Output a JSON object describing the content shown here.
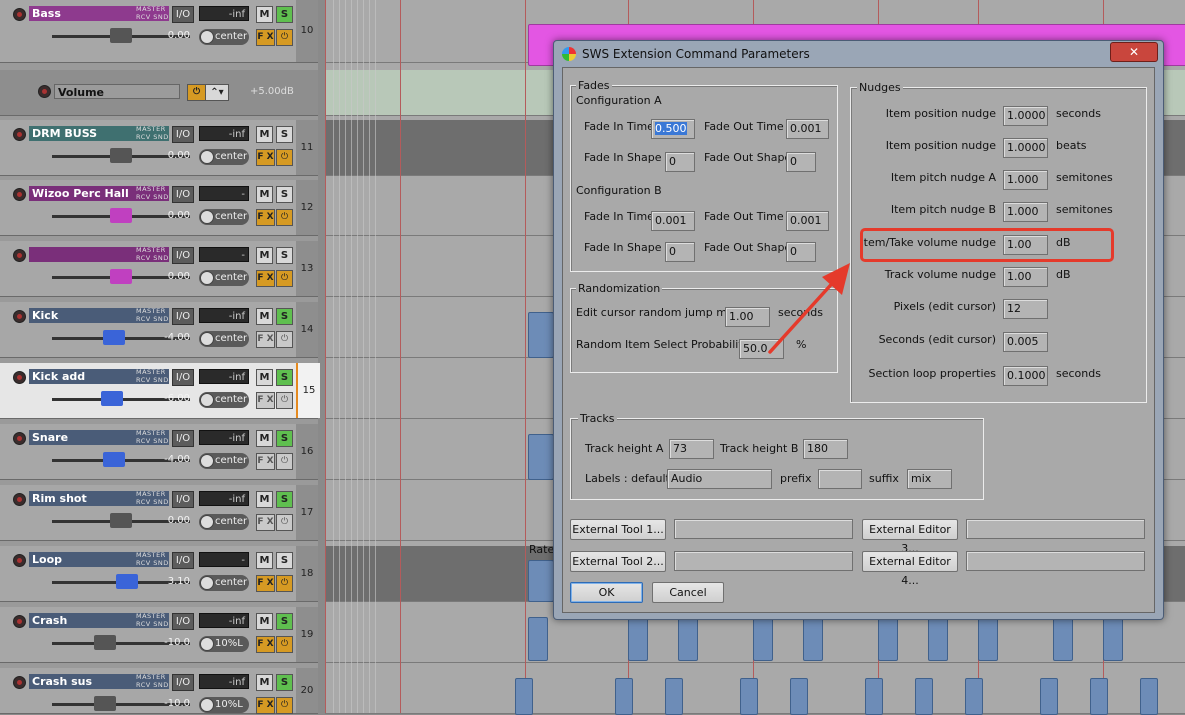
{
  "tracks": [
    {
      "num": "10",
      "name": "Bass",
      "io": "I/O",
      "meter": "-inf",
      "db": "0.00",
      "pan": "center",
      "solo_on": true,
      "fx_on": true,
      "color": "#8e3a8e",
      "knob_color": "#555555",
      "fader": 0.5
    },
    {
      "num": "",
      "name": "Volume",
      "env": true,
      "env_value": "+5.00dB"
    },
    {
      "num": "11",
      "name": "DRM BUSS",
      "io": "I/O",
      "meter": "-inf",
      "db": "0.00",
      "pan": "center",
      "solo_on": false,
      "fx_on": true,
      "color": "#3f7070",
      "knob_color": "#555555",
      "fader": 0.5
    },
    {
      "num": "12",
      "name": "Wizoo Perc Hall",
      "io": "I/O",
      "meter": "-",
      "db": "0.00",
      "pan": "center",
      "solo_on": false,
      "fx_on": true,
      "color": "#7a2f7a",
      "knob_color": "#c040c0",
      "fader": 0.5
    },
    {
      "num": "13",
      "name": "",
      "io": "I/O",
      "meter": "-",
      "db": "0.00",
      "pan": "center",
      "solo_on": false,
      "fx_on": true,
      "color": "#7a2f7a",
      "knob_color": "#c040c0",
      "fader": 0.5
    },
    {
      "num": "14",
      "name": "Kick",
      "io": "I/O",
      "meter": "-inf",
      "db": "-4.00",
      "pan": "center",
      "solo_on": true,
      "fx_on": false,
      "color": "#4a5c78",
      "knob_color": "#3a64d8",
      "fader": 0.44
    },
    {
      "num": "15",
      "name": "Kick add",
      "io": "I/O",
      "meter": "-inf",
      "db": "-6.00",
      "pan": "center",
      "solo_on": true,
      "fx_on": false,
      "color": "#4a5c78",
      "knob_color": "#3a64d8",
      "fader": 0.42,
      "selected": true
    },
    {
      "num": "16",
      "name": "Snare",
      "io": "I/O",
      "meter": "-inf",
      "db": "-4.00",
      "pan": "center",
      "solo_on": true,
      "fx_on": false,
      "color": "#4a5c78",
      "knob_color": "#3a64d8",
      "fader": 0.44
    },
    {
      "num": "17",
      "name": "Rim shot",
      "io": "I/O",
      "meter": "-inf",
      "db": "0.00",
      "pan": "center",
      "solo_on": true,
      "fx_on": false,
      "color": "#4a5c78",
      "knob_color": "#555555",
      "fader": 0.5
    },
    {
      "num": "18",
      "name": "Loop",
      "io": "I/O",
      "meter": "-",
      "db": "3.10",
      "pan": "center",
      "solo_on": false,
      "fx_on": true,
      "color": "#4a5c78",
      "knob_color": "#3a64d8",
      "fader": 0.55
    },
    {
      "num": "19",
      "name": "Crash",
      "io": "I/O",
      "meter": "-inf",
      "db": "-10.0",
      "pan": "10%L",
      "solo_on": true,
      "fx_on": true,
      "color": "#4a5c78",
      "knob_color": "#555555",
      "fader": 0.36
    },
    {
      "num": "20",
      "name": "Crash  sus",
      "io": "I/O",
      "meter": "-inf",
      "db": "-10.0",
      "pan": "10%L",
      "solo_on": true,
      "fx_on": true,
      "color": "#4a5c78",
      "knob_color": "#555555",
      "fader": 0.36
    }
  ],
  "track_labels": {
    "master": "MASTER",
    "rcv": "RCV SND",
    "mute": "M",
    "solo": "S",
    "fx": "F X",
    "power": "⏻"
  },
  "arrange": {
    "clip_label": "Rate"
  },
  "dialog": {
    "title": "SWS Extension Command Parameters",
    "close": "✕",
    "fades": {
      "group": "Fades",
      "config_a": "Configuration A",
      "config_b": "Configuration B",
      "fade_in_time": "Fade In Time",
      "fade_out_time": "Fade Out Time",
      "fade_in_shape": "Fade In Shape",
      "fade_out_shape": "Fade Out Shape",
      "a_in_time": "0.500",
      "a_out_time": "0.001",
      "a_in_shape": "0",
      "a_out_shape": "0",
      "b_in_time": "0.001",
      "b_out_time": "0.001",
      "b_in_shape": "0",
      "b_out_shape": "0"
    },
    "randomization": {
      "group": "Randomization",
      "jump_label": "Edit cursor random jump mean",
      "jump_value": "1.00",
      "jump_unit": "seconds",
      "prob_label": "Random Item Select Probability",
      "prob_value": "50.0",
      "prob_unit": "%"
    },
    "nudges": {
      "group": "Nudges",
      "rows": [
        {
          "label": "Item position nudge",
          "value": "1.0000",
          "unit": "seconds"
        },
        {
          "label": "Item position nudge",
          "value": "1.0000",
          "unit": "beats"
        },
        {
          "label": "Item pitch nudge A",
          "value": "1.000",
          "unit": "semitones"
        },
        {
          "label": "Item pitch nudge B",
          "value": "1.000",
          "unit": "semitones"
        },
        {
          "label": "Item/Take volume nudge",
          "value": "1.00",
          "unit": "dB"
        },
        {
          "label": "Track volume nudge",
          "value": "1.00",
          "unit": "dB"
        },
        {
          "label": "Pixels (edit cursor)",
          "value": "12",
          "unit": ""
        },
        {
          "label": "Seconds (edit cursor)",
          "value": "0.005",
          "unit": ""
        },
        {
          "label": "Section loop properties",
          "value": "0.1000",
          "unit": "seconds"
        }
      ]
    },
    "tracks": {
      "group": "Tracks",
      "height_a_label": "Track height A",
      "height_a": "73",
      "height_b_label": "Track height B",
      "height_b": "180",
      "labels_label": "Labels : default",
      "labels_default": "Audio",
      "prefix_label": "prefix",
      "prefix": "",
      "suffix_label": "suffix",
      "suffix": "mix"
    },
    "tools": {
      "ext_tool_1": "External Tool 1...",
      "ext_tool_2": "External Tool 2...",
      "ext_editor_3": "External Editor 3...",
      "ext_editor_4": "External Editor 4...",
      "ext_tool_1_path": "",
      "ext_tool_2_path": "",
      "ext_editor_3_path": "",
      "ext_editor_4_path": ""
    },
    "ok": "OK",
    "cancel": "Cancel"
  },
  "colors": {
    "highlight": "#e53a2b",
    "selected_text": "#3a78d6",
    "clip_pink": "#e356e3",
    "clip_blue": "#6d8cb7"
  }
}
